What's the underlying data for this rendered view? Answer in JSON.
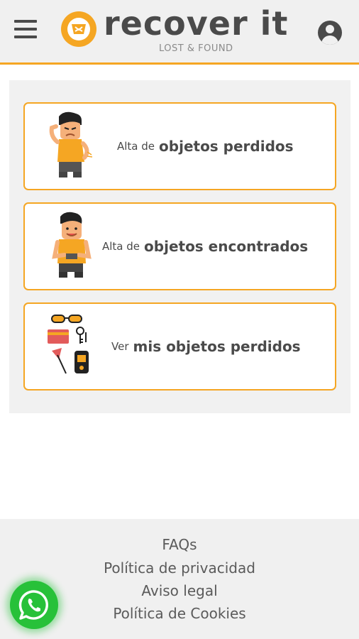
{
  "header": {
    "brand": "recover it",
    "tagline": "LOST & FOUND",
    "menu_icon": "hamburger-menu-icon",
    "account_icon": "user-account-icon",
    "accent_color": "#f5a623"
  },
  "cards": [
    {
      "prefix": "Alta de",
      "emphasis": "objetos perdidos",
      "icon": "worried-person-illustration"
    },
    {
      "prefix": "Alta de",
      "emphasis": "objetos encontrados",
      "icon": "happy-person-illustration"
    },
    {
      "prefix": "Ver",
      "emphasis": "mis objetos perdidos",
      "icon": "lost-objects-illustration"
    }
  ],
  "footer": {
    "links": [
      "FAQs",
      "Política de privacidad",
      "Aviso legal",
      "Política de Cookies"
    ]
  },
  "whatsapp": {
    "icon": "whatsapp-icon",
    "color": "#27c139"
  }
}
